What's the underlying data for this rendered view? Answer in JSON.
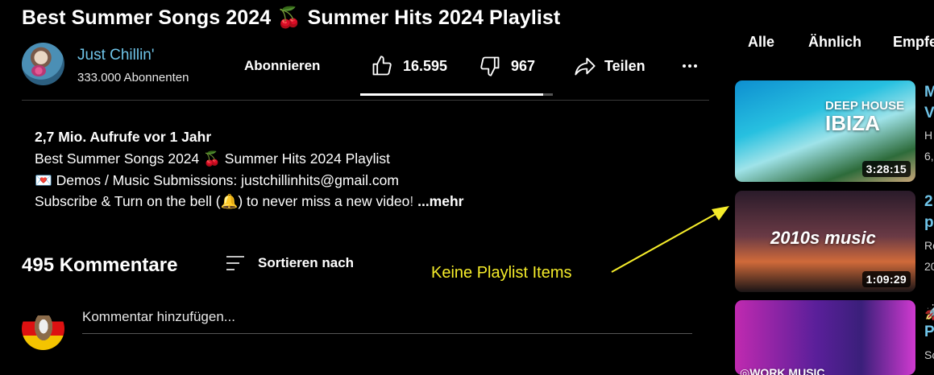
{
  "video": {
    "title": "Best Summer Songs 2024 🍒 Summer Hits 2024 Playlist"
  },
  "channel": {
    "name": "Just Chillin'",
    "subscribers": "333.000 Abonnenten",
    "subscribe_label": "Abonnieren"
  },
  "actions": {
    "likes": "16.595",
    "dislikes": "967",
    "share_label": "Teilen",
    "like_ratio": 0.95
  },
  "description": {
    "line1": "2,7 Mio. Aufrufe  vor 1 Jahr",
    "line2": "Best Summer Songs 2024 🍒 Summer Hits 2024 Playlist",
    "line3": "💌 Demos / Music Submissions: justchillinhits@gmail.com",
    "line4_main": "Subscribe & Turn on the bell (🔔) to never miss a new video",
    "line4_fade": "!",
    "more_label": "...mehr"
  },
  "comments": {
    "count_label": "495 Kommentare",
    "sort_label": "Sortieren nach",
    "add_placeholder": "Kommentar hinzufügen..."
  },
  "annotation": {
    "text": "Keine Playlist Items",
    "color": "#f5ec2a"
  },
  "chips": [
    "Alle",
    "Ähnlich",
    "Empfe"
  ],
  "sidebar": {
    "items": [
      {
        "thumb_text_top": "DEEP HOUSE",
        "thumb_text_main": "IBIZA",
        "duration": "3:28:15",
        "title_lines": [
          "M",
          "V"
        ],
        "meta_lines": [
          "H",
          "6,"
        ]
      },
      {
        "thumb_text_main": "2010s music",
        "duration": "1:09:29",
        "title_lines": [
          "2",
          "p"
        ],
        "meta_lines": [
          "Re",
          "20"
        ]
      },
      {
        "thumb_text_main": "◎WORK MUSIC",
        "title_lines": [
          "🚀",
          "P"
        ],
        "meta_lines": [
          "Sc"
        ]
      }
    ]
  },
  "colors": {
    "background": "#000000",
    "link_blue": "#6fc4e8"
  }
}
